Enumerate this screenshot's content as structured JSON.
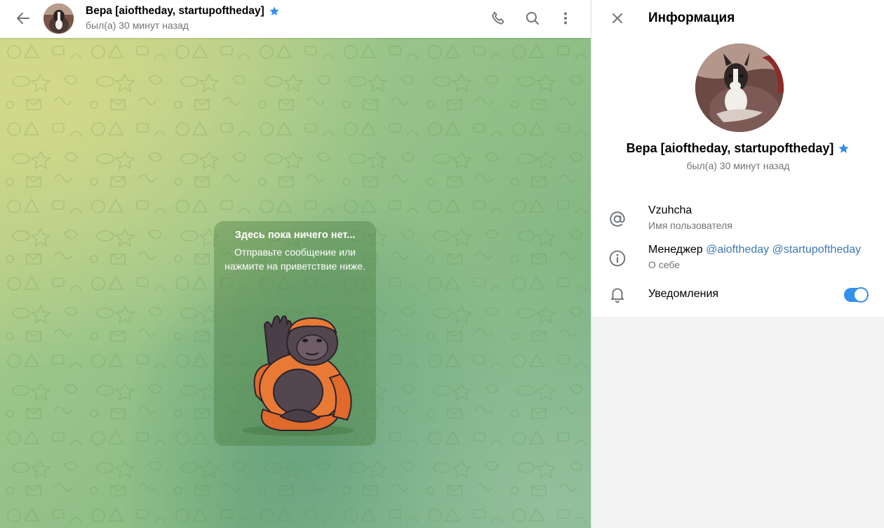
{
  "chat_header": {
    "title": "Вера [aioftheday, startupoftheday]",
    "status": "был(а) 30 минут назад"
  },
  "empty_chat": {
    "title": "Здесь пока ничего нет...",
    "text": "Отправьте сообщение или нажмите на приветствие ниже."
  },
  "info_panel": {
    "heading": "Информация",
    "name": "Вера [aioftheday, startupoftheday]",
    "status": "был(а) 30 минут назад",
    "username": "Vzuhcha",
    "username_label": "Имя пользователя",
    "bio_prefix": "Менеджер",
    "bio_link_1": "@aioftheday",
    "bio_link_2": "@startupoftheday",
    "bio_label": "О себе",
    "notifications_label": "Уведомления",
    "notifications_on": true
  },
  "colors": {
    "accent": "#3390ec",
    "link": "#3e78b2",
    "secondary_text": "#707579",
    "verified_star": "#3390ec"
  },
  "icons": [
    "back-arrow-icon",
    "phone-icon",
    "search-icon",
    "more-vertical-icon",
    "close-icon",
    "at-sign-icon",
    "info-icon",
    "bell-icon",
    "verified-star-icon"
  ]
}
